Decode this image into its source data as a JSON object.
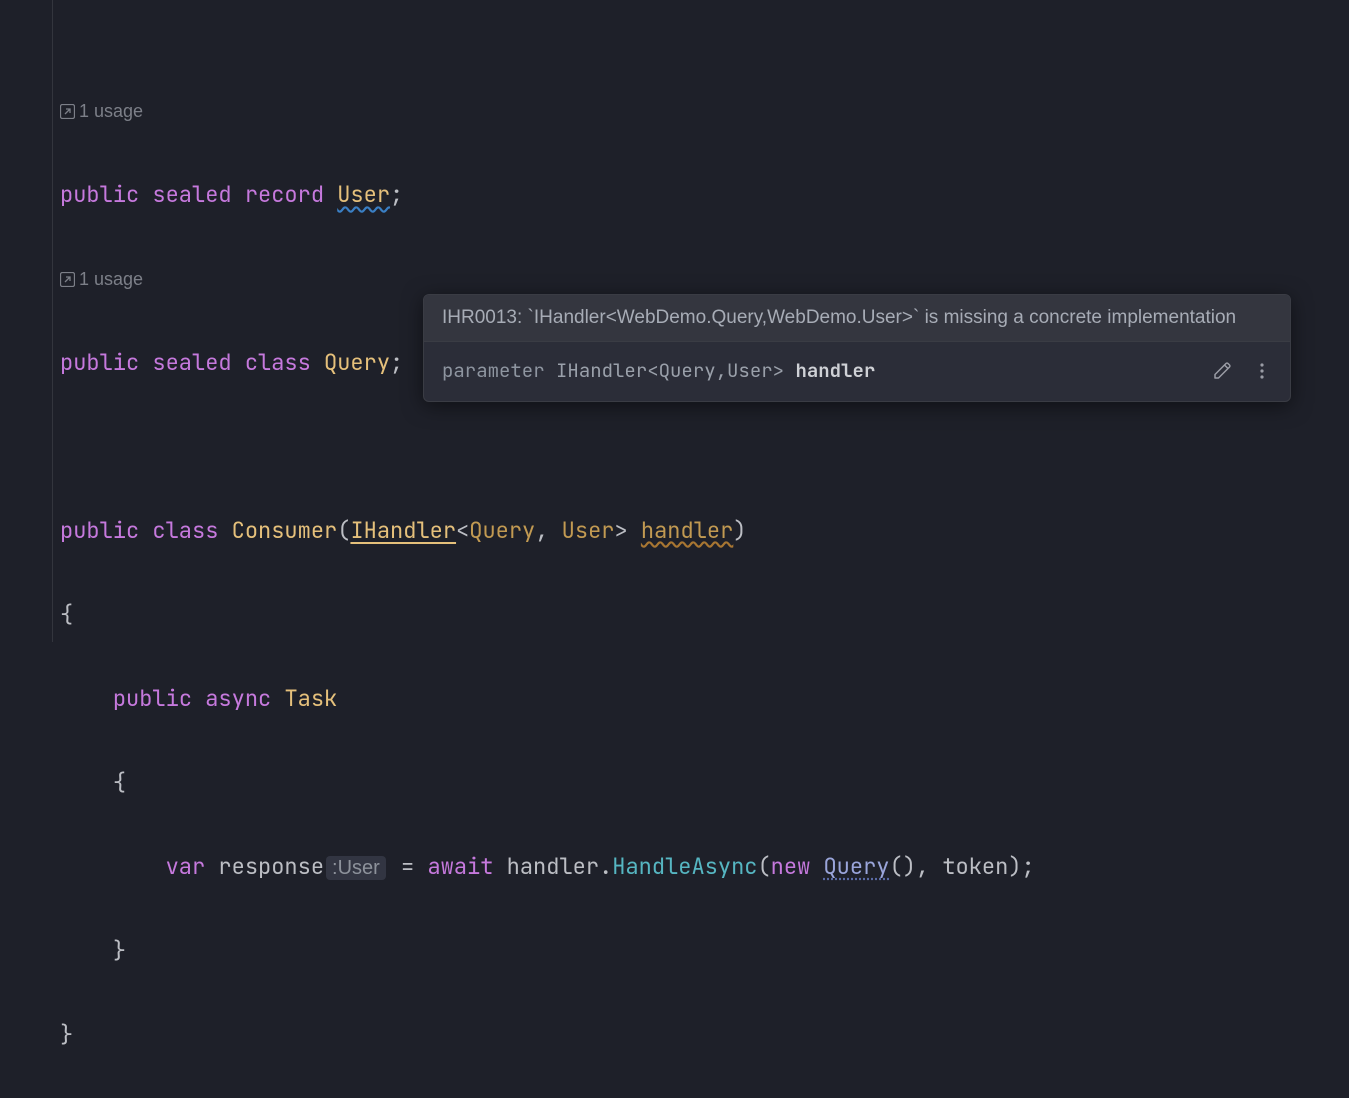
{
  "usage_text": "1 usage",
  "line1": {
    "public": "public",
    "sealed": "sealed",
    "record": "record",
    "name": "User",
    "semi": ";"
  },
  "line2": {
    "public": "public",
    "sealed": "sealed",
    "class": "class",
    "name": "Query",
    "semi": ";"
  },
  "consumer": {
    "public": "public",
    "class": "class",
    "name": "Consumer",
    "open": "(",
    "handler_type": "IHandler",
    "lt": "<",
    "gp1": "Query",
    "comma": ", ",
    "gp2": "User",
    "gt": ">",
    "param": "handler",
    "close": ")"
  },
  "method": {
    "public": "public",
    "async": "async",
    "task": "Task"
  },
  "body": {
    "var": "var",
    "resp": "response",
    "hint_user": ":User",
    "eq": " = ",
    "await": "await",
    "handler": "handler",
    "dot": ".",
    "call": "HandleAsync",
    "open": "(",
    "new": "new",
    "query": "Query",
    "close_inner": "()",
    "comma": ", ",
    "token": "token",
    "close": ");"
  },
  "tooltip": {
    "code": "IHR0013",
    "msg_prefix": ": `IHandler<WebDemo.Query,WebDemo.User>` is missing a concrete implementation",
    "param_kw": "parameter ",
    "param_type": "IHandler<Query,User>",
    "param_name": "handler"
  }
}
